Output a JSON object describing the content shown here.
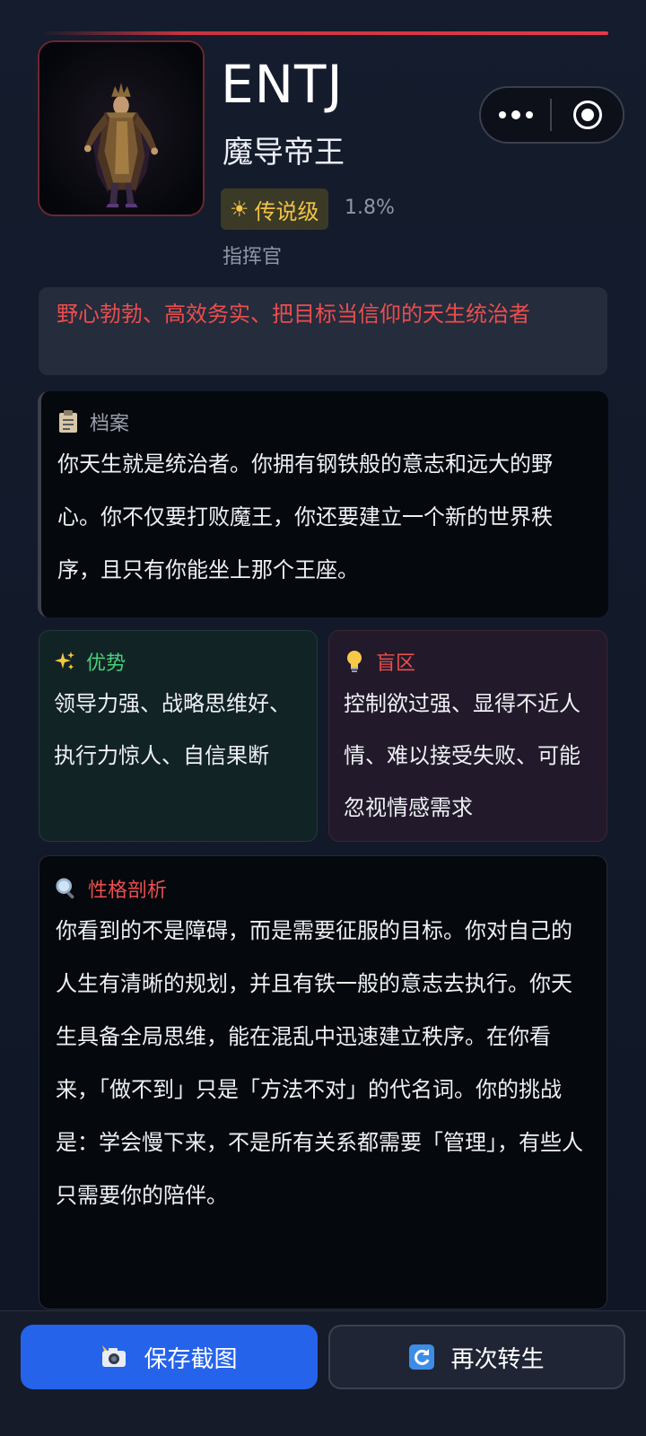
{
  "profile": {
    "type_code": "ENTJ",
    "title": "魔导帝王",
    "rarity_label": "传说级",
    "rarity_icon": "sun-icon",
    "percent": "1.8%",
    "role": "指挥官"
  },
  "tagline": "野心勃勃、高效务实、把目标当信仰的天生统治者",
  "archive": {
    "title": "档案",
    "icon": "clipboard-icon",
    "text": "你天生就是统治者。你拥有钢铁般的意志和远大的野心。你不仅要打败魔王，你还要建立一个新的世界秩序，且只有你能坐上那个王座。"
  },
  "strengths": {
    "title": "优势",
    "icon": "sparkles-icon",
    "text": "领导力强、战略思维好、执行力惊人、自信果断"
  },
  "blind_spots": {
    "title": "盲区",
    "icon": "lightbulb-icon",
    "text": "控制欲过强、显得不近人情、难以接受失败、可能忽视情感需求"
  },
  "analysis": {
    "title": "性格剖析",
    "icon": "magnifier-icon",
    "text": "你看到的不是障碍，而是需要征服的目标。你对自己的人生有清晰的规划，并且有铁一般的意志去执行。你天生具备全局思维，能在混乱中迅速建立秩序。在你看来，「做不到」只是「方法不对」的代名词。你的挑战是：学会慢下来，不是所有关系都需要「管理」，有些人只需要你的陪伴。"
  },
  "actions": {
    "save_label": "保存截图",
    "save_icon": "camera-flash-icon",
    "reborn_label": "再次转生",
    "reborn_icon": "refresh-icon"
  },
  "colors": {
    "accent_red": "#ea4e4e",
    "accent_green": "#46d07a",
    "accent_gold": "#f3c245",
    "primary_blue": "#2563eb"
  }
}
